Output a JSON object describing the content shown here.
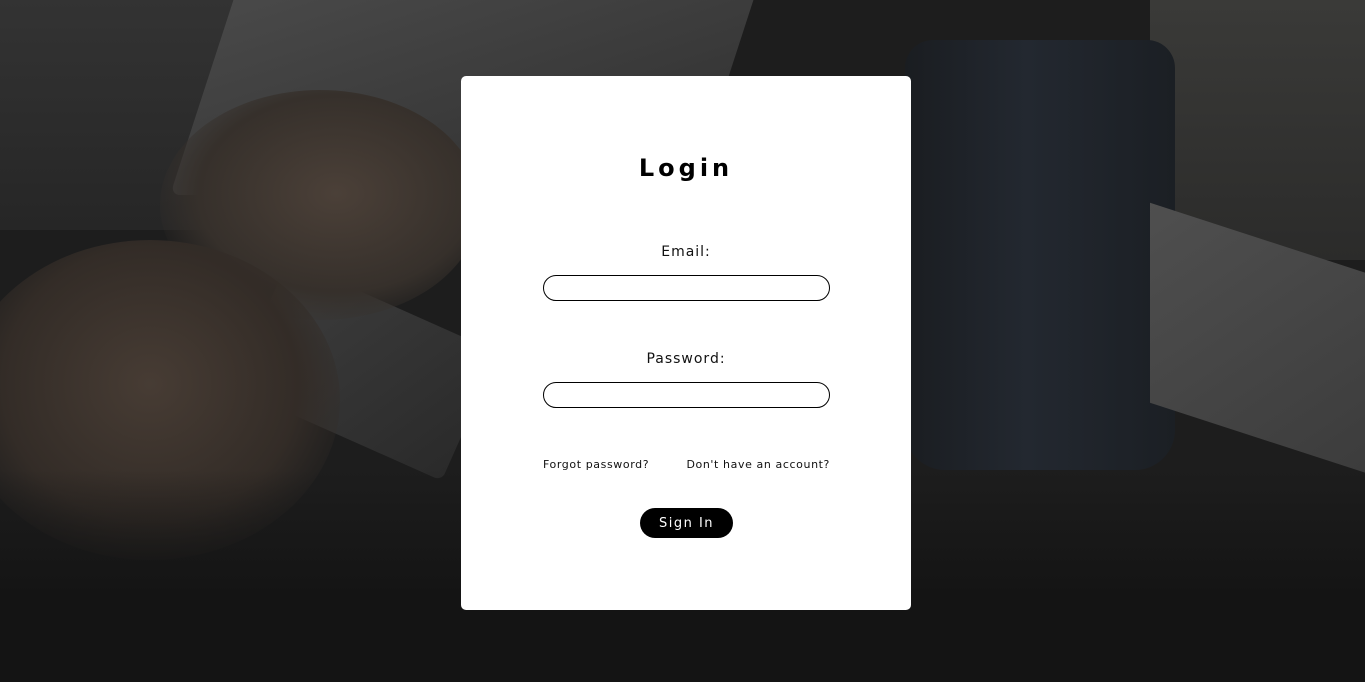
{
  "login": {
    "title": "Login",
    "email_label": "Email:",
    "email_value": "",
    "password_label": "Password:",
    "password_value": "",
    "forgot_link": "Forgot password?",
    "signup_link": "Don't have an account?",
    "signin_button": "Sign In"
  },
  "colors": {
    "card": "#ffffff",
    "button": "#000000",
    "text": "#000000"
  }
}
